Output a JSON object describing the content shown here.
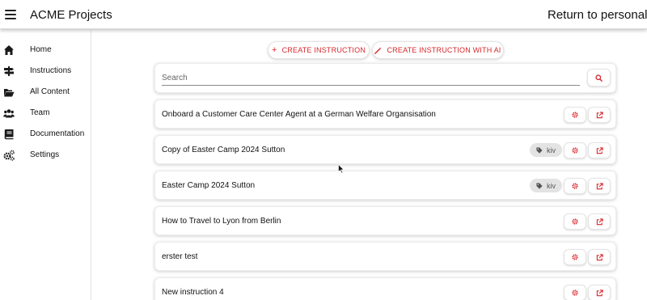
{
  "header": {
    "title": "ACME Projects",
    "return_link": "Return to personal sp"
  },
  "sidebar": {
    "items": [
      {
        "label": "Home",
        "icon": "home-icon"
      },
      {
        "label": "Instructions",
        "icon": "signpost-icon"
      },
      {
        "label": "All Content",
        "icon": "folder-open-icon"
      },
      {
        "label": "Team",
        "icon": "users-icon"
      },
      {
        "label": "Documentation",
        "icon": "book-icon"
      },
      {
        "label": "Settings",
        "icon": "cogs-icon"
      }
    ]
  },
  "actions": {
    "create_instruction": "CREATE INSTRUCTION",
    "create_instruction_ai": "CREATE INSTRUCTION WITH AI"
  },
  "search": {
    "placeholder": "Search",
    "value": ""
  },
  "instructions": [
    {
      "title": "Onboard a Customer Care Center Agent at a German Welfare Organsisation",
      "tag": ""
    },
    {
      "title": "Copy of Easter Camp 2024 Sutton",
      "tag": "kiv"
    },
    {
      "title": "Easter Camp 2024 Sutton",
      "tag": "kiv"
    },
    {
      "title": "How to Travel to Lyon from Berlin",
      "tag": ""
    },
    {
      "title": "erster test",
      "tag": ""
    },
    {
      "title": "New instruction 4",
      "tag": ""
    }
  ],
  "colors": {
    "accent": "#d8262b",
    "tag_bg": "#e3e3e3",
    "text": "#111111"
  }
}
